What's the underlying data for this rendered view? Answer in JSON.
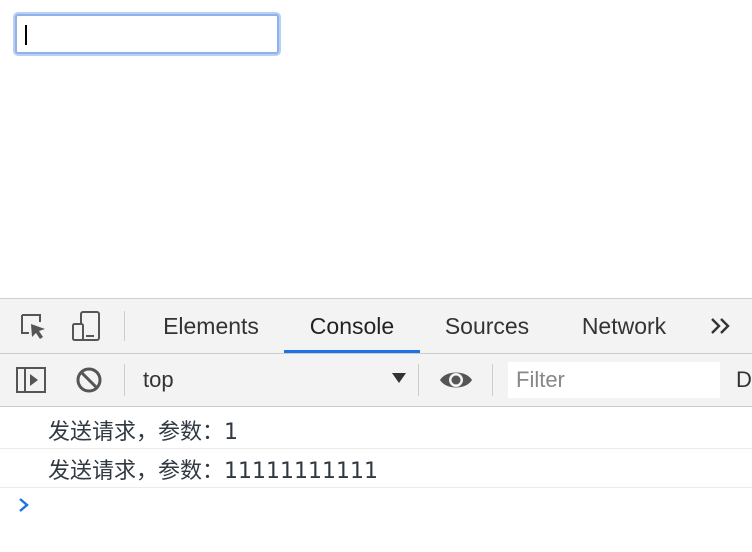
{
  "page": {
    "input_value": ""
  },
  "devtools": {
    "tabs": [
      {
        "label": "Elements"
      },
      {
        "label": "Console"
      },
      {
        "label": "Sources"
      },
      {
        "label": "Network"
      }
    ],
    "active_tab": "Console",
    "overflow_icon": "chevron-double-right-icon",
    "toolbar": {
      "context": "top",
      "filter_placeholder": "Filter",
      "truncated_label": "D"
    },
    "console": {
      "messages": [
        "发送请求，参数：1",
        "发送请求，参数：11111111111"
      ]
    },
    "colors": {
      "accent": "#1a73e8",
      "toolbar_bg": "#f3f3f3"
    }
  }
}
